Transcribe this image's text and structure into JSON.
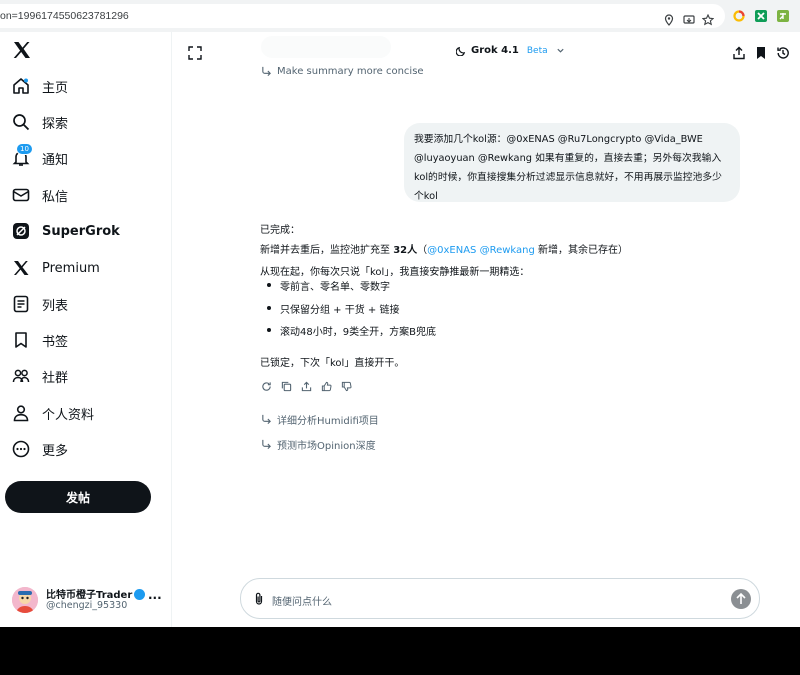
{
  "browser": {
    "url": "on=1996174550623781296",
    "ext_colors": [
      "#34a853",
      "#1a73e8",
      "#ea4335",
      "#7cb342"
    ]
  },
  "sidebar": {
    "items": [
      {
        "label": "主页",
        "icon": "home-icon",
        "bold": false,
        "badge": ""
      },
      {
        "label": "探索",
        "icon": "search-icon",
        "bold": false,
        "badge": ""
      },
      {
        "label": "通知",
        "icon": "bell-icon",
        "bold": false,
        "badge": "10"
      },
      {
        "label": "私信",
        "icon": "envelope-icon",
        "bold": false,
        "badge": ""
      },
      {
        "label": "SuperGrok",
        "icon": "grok-icon",
        "bold": true,
        "badge": ""
      },
      {
        "label": "Premium",
        "icon": "x-icon",
        "bold": false,
        "badge": ""
      },
      {
        "label": "列表",
        "icon": "list-icon",
        "bold": false,
        "badge": ""
      },
      {
        "label": "书签",
        "icon": "bookmark-icon",
        "bold": false,
        "badge": ""
      },
      {
        "label": "社群",
        "icon": "people-icon",
        "bold": false,
        "badge": ""
      },
      {
        "label": "个人资料",
        "icon": "person-icon",
        "bold": false,
        "badge": ""
      },
      {
        "label": "更多",
        "icon": "more-circle-icon",
        "bold": false,
        "badge": ""
      }
    ],
    "post_label": "发帖",
    "profile": {
      "name": "比特币橙子Trader",
      "handle": "@chengzi_95330"
    }
  },
  "main": {
    "model_name": "Grok 4.1",
    "model_badge": "Beta",
    "suggest_top": "Make summary more concise",
    "user_message": "我要添加几个kol源：@0xENAS @Ru7Longcrypto @Vida_BWE @luyaoyuan @Rewkang 如果有重复的，直接去重；另外每次我输入kol的时候，你直接搜集分析过滤显示信息就好，不用再展示监控池多少个kol",
    "response": {
      "done": "已完成：",
      "line1_pre": "新增并去重后，监控池扩充至 ",
      "line1_bold": "32人",
      "line1_paren_open": "（",
      "line1_mention1": "@0xENAS",
      "line1_mention2": "@Rewkang",
      "line1_post": " 新增，其余已存在）",
      "line2": "从现在起，你每次只说「kol」，我直接安静推最新一期精选：",
      "bullets": [
        "零前言、零名单、零数字",
        "只保留分组 + 干货 + 链接",
        "滚动48小时，9类全开，方案B兜底"
      ],
      "line3": "已锁定，下次「kol」直接开干。"
    },
    "suggestions": [
      "详细分析Humidifi项目",
      "预测市场Opinion深度"
    ],
    "composer_placeholder": "随便问点什么"
  }
}
